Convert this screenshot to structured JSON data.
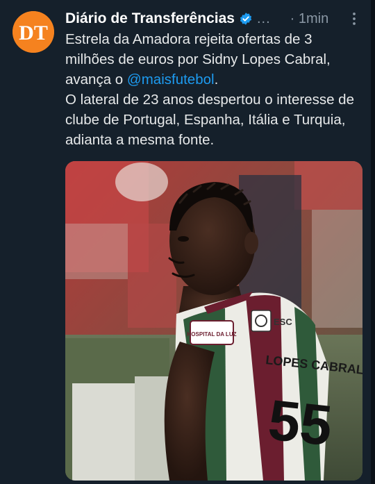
{
  "author": {
    "display_name": "Diário de Transferências",
    "handle_truncated": "...",
    "avatar_text": "DT",
    "avatar_color": "#f5821f",
    "verified_icon": "verified-badge-icon"
  },
  "timestamp": "· 1min",
  "menu_icon": "more-vertical-icon",
  "tweet": {
    "line1": "Estrela da Amadora rejeita ofertas de 3",
    "line2": "milhões de euros por Sidny Lopes Cabral,",
    "line3_prefix": "avança o ",
    "mention": "@maisfutebol",
    "line3_suffix": ".",
    "paragraph2": "O lateral de 23 anos despertou o interesse de clube de Portugal, Espanha, Itália e Turquia, adianta a mesma fonte."
  },
  "media": {
    "jersey_sponsor": "HOSPITAL DA LUZ",
    "jersey_badge": "ESC",
    "jersey_name": "LOPES CABRAL",
    "jersey_number": "55"
  },
  "colors": {
    "background": "#15202b",
    "text": "#e7e9ea",
    "muted": "#8b98a5",
    "link": "#1d9bf0",
    "verified": "#1d9bf0"
  }
}
